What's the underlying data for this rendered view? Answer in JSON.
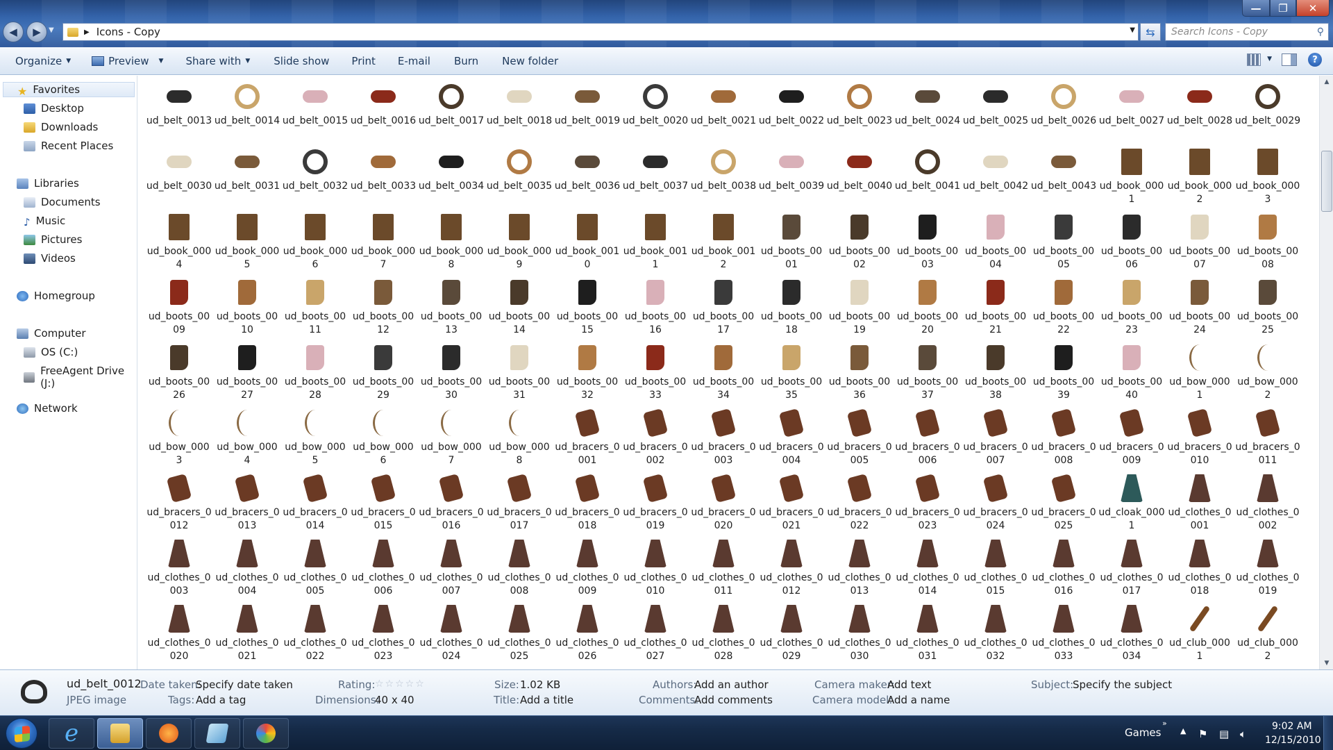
{
  "window": {
    "address": "Icons - Copy",
    "search_placeholder": "Search Icons - Copy",
    "minimize": "—",
    "maximize": "❐",
    "close": "✕"
  },
  "toolbar": {
    "organize": "Organize",
    "preview": "Preview",
    "share_with": "Share with",
    "slide_show": "Slide show",
    "print": "Print",
    "email": "E-mail",
    "burn": "Burn",
    "new_folder": "New folder",
    "help": "?"
  },
  "nav": {
    "favorites": "Favorites",
    "desktop": "Desktop",
    "downloads": "Downloads",
    "recent": "Recent Places",
    "libraries": "Libraries",
    "documents": "Documents",
    "music": "Music",
    "pictures": "Pictures",
    "videos": "Videos",
    "homegroup": "Homegroup",
    "computer": "Computer",
    "os_drive": "OS (C:)",
    "freeagent": "FreeAgent Drive (J:)",
    "network": "Network"
  },
  "files": [
    "ud_belt_0013",
    "ud_belt_0014",
    "ud_belt_0015",
    "ud_belt_0016",
    "ud_belt_0017",
    "ud_belt_0018",
    "ud_belt_0019",
    "ud_belt_0020",
    "ud_belt_0021",
    "ud_belt_0022",
    "ud_belt_0023",
    "ud_belt_0024",
    "ud_belt_0025",
    "ud_belt_0026",
    "ud_belt_0027",
    "ud_belt_0028",
    "ud_belt_0029",
    "ud_belt_0030",
    "ud_belt_0031",
    "ud_belt_0032",
    "ud_belt_0033",
    "ud_belt_0034",
    "ud_belt_0035",
    "ud_belt_0036",
    "ud_belt_0037",
    "ud_belt_0038",
    "ud_belt_0039",
    "ud_belt_0040",
    "ud_belt_0041",
    "ud_belt_0042",
    "ud_belt_0043",
    "ud_book_0001",
    "ud_book_0002",
    "ud_book_0003",
    "ud_book_0004",
    "ud_book_0005",
    "ud_book_0006",
    "ud_book_0007",
    "ud_book_0008",
    "ud_book_0009",
    "ud_book_0010",
    "ud_book_0011",
    "ud_book_0012",
    "ud_boots_0001",
    "ud_boots_0002",
    "ud_boots_0003",
    "ud_boots_0004",
    "ud_boots_0005",
    "ud_boots_0006",
    "ud_boots_0007",
    "ud_boots_0008",
    "ud_boots_0009",
    "ud_boots_0010",
    "ud_boots_0011",
    "ud_boots_0012",
    "ud_boots_0013",
    "ud_boots_0014",
    "ud_boots_0015",
    "ud_boots_0016",
    "ud_boots_0017",
    "ud_boots_0018",
    "ud_boots_0019",
    "ud_boots_0020",
    "ud_boots_0021",
    "ud_boots_0022",
    "ud_boots_0023",
    "ud_boots_0024",
    "ud_boots_0025",
    "ud_boots_0026",
    "ud_boots_0027",
    "ud_boots_0028",
    "ud_boots_0029",
    "ud_boots_0030",
    "ud_boots_0031",
    "ud_boots_0032",
    "ud_boots_0033",
    "ud_boots_0034",
    "ud_boots_0035",
    "ud_boots_0036",
    "ud_boots_0037",
    "ud_boots_0038",
    "ud_boots_0039",
    "ud_boots_0040",
    "ud_bow_0001",
    "ud_bow_0002",
    "ud_bow_0003",
    "ud_bow_0004",
    "ud_bow_0005",
    "ud_bow_0006",
    "ud_bow_0007",
    "ud_bow_0008",
    "ud_bracers_0001",
    "ud_bracers_0002",
    "ud_bracers_0003",
    "ud_bracers_0004",
    "ud_bracers_0005",
    "ud_bracers_0006",
    "ud_bracers_0007",
    "ud_bracers_0008",
    "ud_bracers_0009",
    "ud_bracers_0010",
    "ud_bracers_0011",
    "ud_bracers_0012",
    "ud_bracers_0013",
    "ud_bracers_0014",
    "ud_bracers_0015",
    "ud_bracers_0016",
    "ud_bracers_0017",
    "ud_bracers_0018",
    "ud_bracers_0019",
    "ud_bracers_0020",
    "ud_bracers_0021",
    "ud_bracers_0022",
    "ud_bracers_0023",
    "ud_bracers_0024",
    "ud_bracers_0025",
    "ud_cloak_0001",
    "ud_clothes_0001",
    "ud_clothes_0002",
    "ud_clothes_0003",
    "ud_clothes_0004",
    "ud_clothes_0005",
    "ud_clothes_0006",
    "ud_clothes_0007",
    "ud_clothes_0008",
    "ud_clothes_0009",
    "ud_clothes_0010",
    "ud_clothes_0011",
    "ud_clothes_0012",
    "ud_clothes_0013",
    "ud_clothes_0014",
    "ud_clothes_0015",
    "ud_clothes_0016",
    "ud_clothes_0017",
    "ud_clothes_0018",
    "ud_clothes_0019",
    "ud_clothes_0020",
    "ud_clothes_0021",
    "ud_clothes_0022",
    "ud_clothes_0023",
    "ud_clothes_0024",
    "ud_clothes_0025",
    "ud_clothes_0026",
    "ud_clothes_0027",
    "ud_clothes_0028",
    "ud_clothes_0029",
    "ud_clothes_0030",
    "ud_clothes_0031",
    "ud_clothes_0032",
    "ud_clothes_0033",
    "ud_clothes_0034",
    "ud_club_0001",
    "ud_club_0002"
  ],
  "details": {
    "filename": "ud_belt_0012",
    "filetype": "JPEG image",
    "date_taken_label": "Date taken:",
    "date_taken_value": "Specify date taken",
    "tags_label": "Tags:",
    "tags_value": "Add a tag",
    "rating_label": "Rating:",
    "rating_stars": "☆☆☆☆☆",
    "dimensions_label": "Dimensions:",
    "dimensions_value": "40 x 40",
    "size_label": "Size:",
    "size_value": "1.02 KB",
    "title_label": "Title:",
    "title_value": "Add a title",
    "authors_label": "Authors:",
    "authors_value": "Add an author",
    "comments_label": "Comments:",
    "comments_value": "Add comments",
    "camera_maker_label": "Camera maker:",
    "camera_maker_value": "Add text",
    "camera_model_label": "Camera model:",
    "camera_model_value": "Add a name",
    "subject_label": "Subject:",
    "subject_value": "Specify the subject"
  },
  "taskbar": {
    "games": "Games",
    "chevron": "»",
    "time": "9:02 AM",
    "date": "12/15/2010"
  },
  "colors": {
    "belt": "#3a2a20",
    "book": "#6b4a2a",
    "boots": "#5a3a22",
    "bow": "#8a6a44",
    "bracers": "#6b3a24",
    "clothes": "#5a3a30",
    "cloak": "#2d5a5a",
    "club": "#7a4a22"
  }
}
